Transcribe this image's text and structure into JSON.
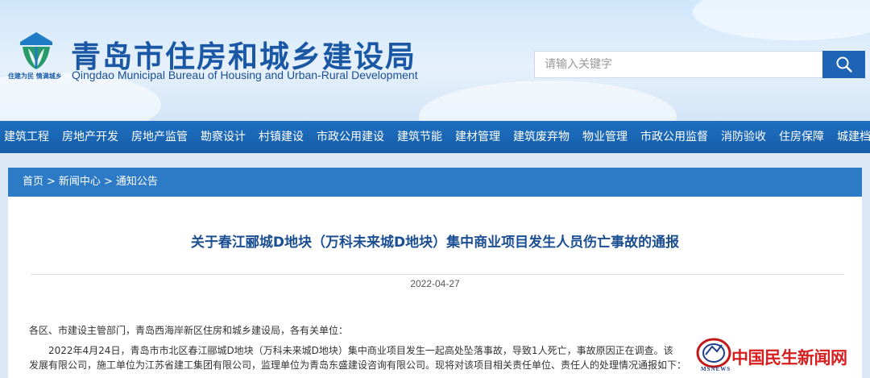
{
  "header": {
    "title": "青岛市住房和城乡建设局",
    "subtitle": "Qingdao Municipal Bureau of Housing and Urban-Rural Development",
    "logo_slogan": "住建为民 情满城乡",
    "search_placeholder": "请输入关键字",
    "search_icon": "search-icon"
  },
  "nav": {
    "items": [
      {
        "label": "建筑工程"
      },
      {
        "label": "房地产开发"
      },
      {
        "label": "房地产监管"
      },
      {
        "label": "勘察设计"
      },
      {
        "label": "村镇建设"
      },
      {
        "label": "市政公用建设"
      },
      {
        "label": "建筑节能"
      },
      {
        "label": "建材管理"
      },
      {
        "label": "建筑废弃物"
      },
      {
        "label": "物业管理"
      },
      {
        "label": "市政公用监督"
      },
      {
        "label": "消防验收"
      },
      {
        "label": "住房保障"
      },
      {
        "label": "城建档"
      }
    ]
  },
  "breadcrumb": {
    "items": [
      "首页",
      "新闻中心",
      "通知公告"
    ],
    "separator": ">"
  },
  "article": {
    "title": "关于春江郦城D地块（万科未来城D地块）集中商业项目发生人员伤亡事故的通报",
    "date": "2022-04-27",
    "paragraph1": "各区、市建设主管部门，青岛西海岸新区住房和城乡建设局，各有关单位：",
    "paragraph2": "2022年4月24日，青岛市市北区春江郦城D地块（万科未来城D地块）集中商业项目发生一起高处坠落事故，导致1人死亡，事故原因正在调查。该",
    "paragraph3": "发展有限公司，施工单位为江苏省建工集团有限公司，监理单位为青岛东盛建设咨询有限公司。现将对该项目相关责任单位、责任人的处理情况通报如下："
  },
  "watermark": {
    "text": "中国民生新闻网",
    "sub": "MSNEWS"
  },
  "colors": {
    "nav_bg": "#1a66b3",
    "breadcrumb_bg": "#2d7bc7",
    "title_color": "#1b4f92",
    "brand_blue": "#1a58a6",
    "watermark_red": "#d81e1e"
  }
}
